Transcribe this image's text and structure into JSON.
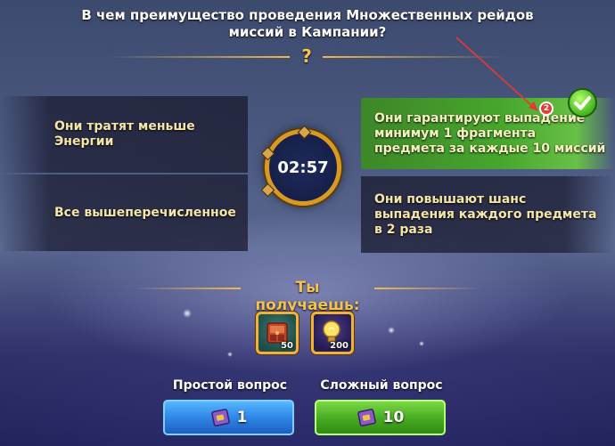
{
  "question": {
    "text": "В чем преимущество проведения Множественных рейдов миссий в Кампании?",
    "mark": "?"
  },
  "answers": [
    {
      "id": "a1",
      "text": "Они тратят меньше Энергии",
      "correct": false
    },
    {
      "id": "a2",
      "text": "Они гарантируют выпадение минимум 1 фрагмента предмета за каждые 10 миссий",
      "correct": true
    },
    {
      "id": "a3",
      "text": "Все вышеперечисленное",
      "correct": false
    },
    {
      "id": "a4",
      "text": "Они повышают шанс выпадения каждого предмета в 2 раза",
      "correct": false
    }
  ],
  "timer": {
    "value": "02:57"
  },
  "annotation": {
    "badge": "2"
  },
  "rewards": {
    "title": "Ты получаешь:",
    "items": [
      {
        "icon": "armor-chest-icon",
        "quantity": "50"
      },
      {
        "icon": "lightbulb-icon",
        "quantity": "200"
      }
    ]
  },
  "buttons": {
    "simple": {
      "label": "Простой вопрос",
      "value": "1",
      "icon": "ticket-icon"
    },
    "hard": {
      "label": "Сложный вопрос",
      "value": "10",
      "icon": "ticket-icon"
    }
  },
  "colors": {
    "accent_gold": "#f0b84a",
    "correct_green": "#46aa22",
    "button_blue": "#2f86e6",
    "badge_red": "#e53935"
  }
}
